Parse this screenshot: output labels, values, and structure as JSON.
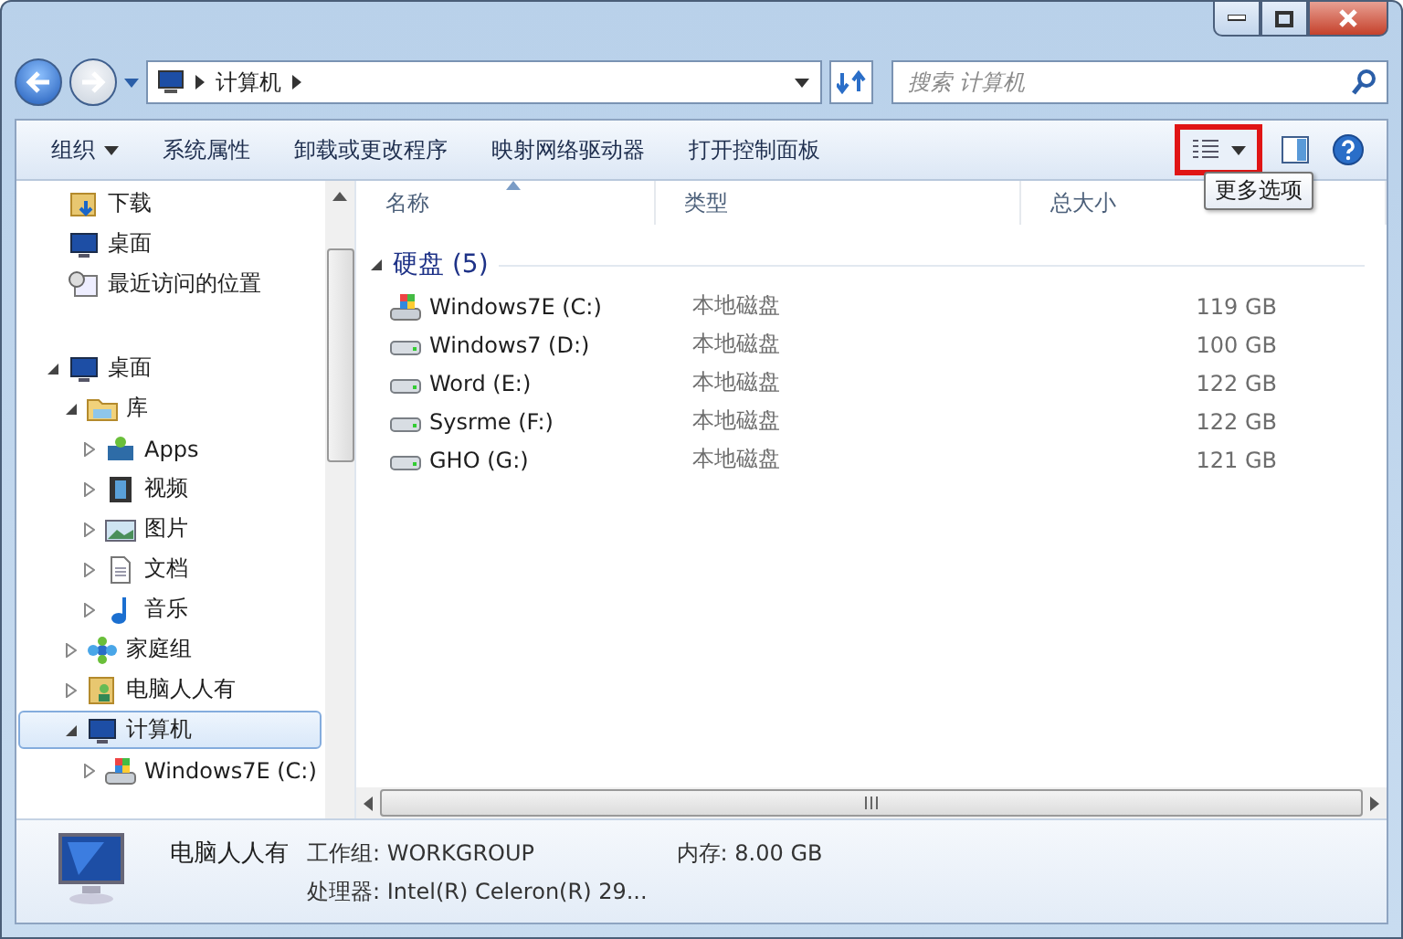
{
  "address_bar": {
    "breadcrumb": [
      "计算机"
    ]
  },
  "search": {
    "placeholder": "搜索 计算机"
  },
  "toolbar": {
    "items": [
      {
        "label": "组织",
        "kind": "menu"
      },
      {
        "label": "系统属性",
        "kind": "command"
      },
      {
        "label": "卸载或更改程序",
        "kind": "command"
      },
      {
        "label": "映射网络驱动器",
        "kind": "command"
      },
      {
        "label": "打开控制面板",
        "kind": "command"
      }
    ],
    "view_button": {
      "highlighted": true
    },
    "tooltip": "更多选项"
  },
  "sidebar": {
    "favorites": [
      {
        "label": "下载",
        "kind": "download"
      },
      {
        "label": "桌面",
        "kind": "desktop"
      },
      {
        "label": "最近访问的位置",
        "kind": "recent"
      }
    ],
    "tree": [
      {
        "label": "桌面",
        "kind": "desktop",
        "expanded": true,
        "selected": false,
        "children": [
          {
            "label": "库",
            "kind": "library",
            "expanded": true,
            "selected": false,
            "children": [
              {
                "label": "Apps",
                "kind": "apps",
                "expanded": false,
                "selected": false
              },
              {
                "label": "视频",
                "kind": "video",
                "expanded": false,
                "selected": false
              },
              {
                "label": "图片",
                "kind": "picture",
                "expanded": false,
                "selected": false
              },
              {
                "label": "文档",
                "kind": "document",
                "expanded": false,
                "selected": false
              },
              {
                "label": "音乐",
                "kind": "music",
                "expanded": false,
                "selected": false
              }
            ]
          },
          {
            "label": "家庭组",
            "kind": "homegroup",
            "expanded": false,
            "selected": false
          },
          {
            "label": "电脑人人有",
            "kind": "user",
            "expanded": false,
            "selected": false
          },
          {
            "label": "计算机",
            "kind": "computer",
            "expanded": true,
            "selected": true,
            "children": [
              {
                "label": "Windows7E (C:)",
                "kind": "system",
                "expanded": false,
                "selected": false
              }
            ]
          }
        ]
      }
    ]
  },
  "table": {
    "columns": [
      {
        "label": "名称",
        "sorted": true
      },
      {
        "label": "类型",
        "sorted": false
      },
      {
        "label": "总大小",
        "sorted": false
      }
    ],
    "group": {
      "title": "硬盘 (5)",
      "expanded": true
    },
    "rows": [
      {
        "kind": "system",
        "name": "Windows7E (C:)",
        "type": "本地磁盘",
        "size": "119 GB"
      },
      {
        "kind": "drive",
        "name": "Windows7 (D:)",
        "type": "本地磁盘",
        "size": "100 GB"
      },
      {
        "kind": "drive",
        "name": "Word (E:)",
        "type": "本地磁盘",
        "size": "122 GB"
      },
      {
        "kind": "drive",
        "name": "Sysrme (F:)",
        "type": "本地磁盘",
        "size": "122 GB"
      },
      {
        "kind": "drive",
        "name": "GHO (G:)",
        "type": "本地磁盘",
        "size": "121 GB"
      }
    ]
  },
  "details": {
    "name": "电脑人人有",
    "fields": [
      {
        "label": "工作组:",
        "value": "WORKGROUP"
      },
      {
        "label": "内存:",
        "value": "8.00 GB"
      },
      {
        "label": "处理器:",
        "value": "Intel(R) Celeron(R) 29..."
      }
    ]
  }
}
